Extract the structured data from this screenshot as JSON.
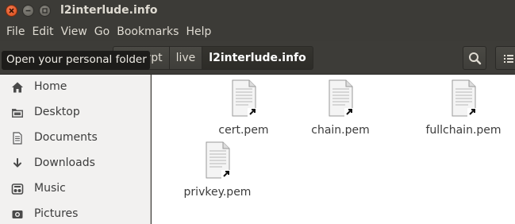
{
  "window": {
    "title": "l2interlude.info"
  },
  "menu": [
    "File",
    "Edit",
    "View",
    "Go",
    "Bookmarks",
    "Help"
  ],
  "breadcrumbs": [
    "encrypt",
    "live",
    "l2interlude.info"
  ],
  "tooltip": "Open your personal folder",
  "sidebar": {
    "items": [
      {
        "label": "Home",
        "icon": "home-icon"
      },
      {
        "label": "Desktop",
        "icon": "desktop-icon"
      },
      {
        "label": "Documents",
        "icon": "documents-icon"
      },
      {
        "label": "Downloads",
        "icon": "downloads-icon"
      },
      {
        "label": "Music",
        "icon": "music-icon"
      },
      {
        "label": "Pictures",
        "icon": "pictures-icon"
      }
    ]
  },
  "files": [
    {
      "name": "cert.pem",
      "icon": "document-link-icon"
    },
    {
      "name": "chain.pem",
      "icon": "document-link-icon"
    },
    {
      "name": "fullchain.pem",
      "icon": "document-link-icon"
    },
    {
      "name": "privkey.pem",
      "icon": "document-link-icon"
    }
  ],
  "toolbar": {
    "search_icon": "search-icon",
    "view_icon": "list-view-icon"
  }
}
